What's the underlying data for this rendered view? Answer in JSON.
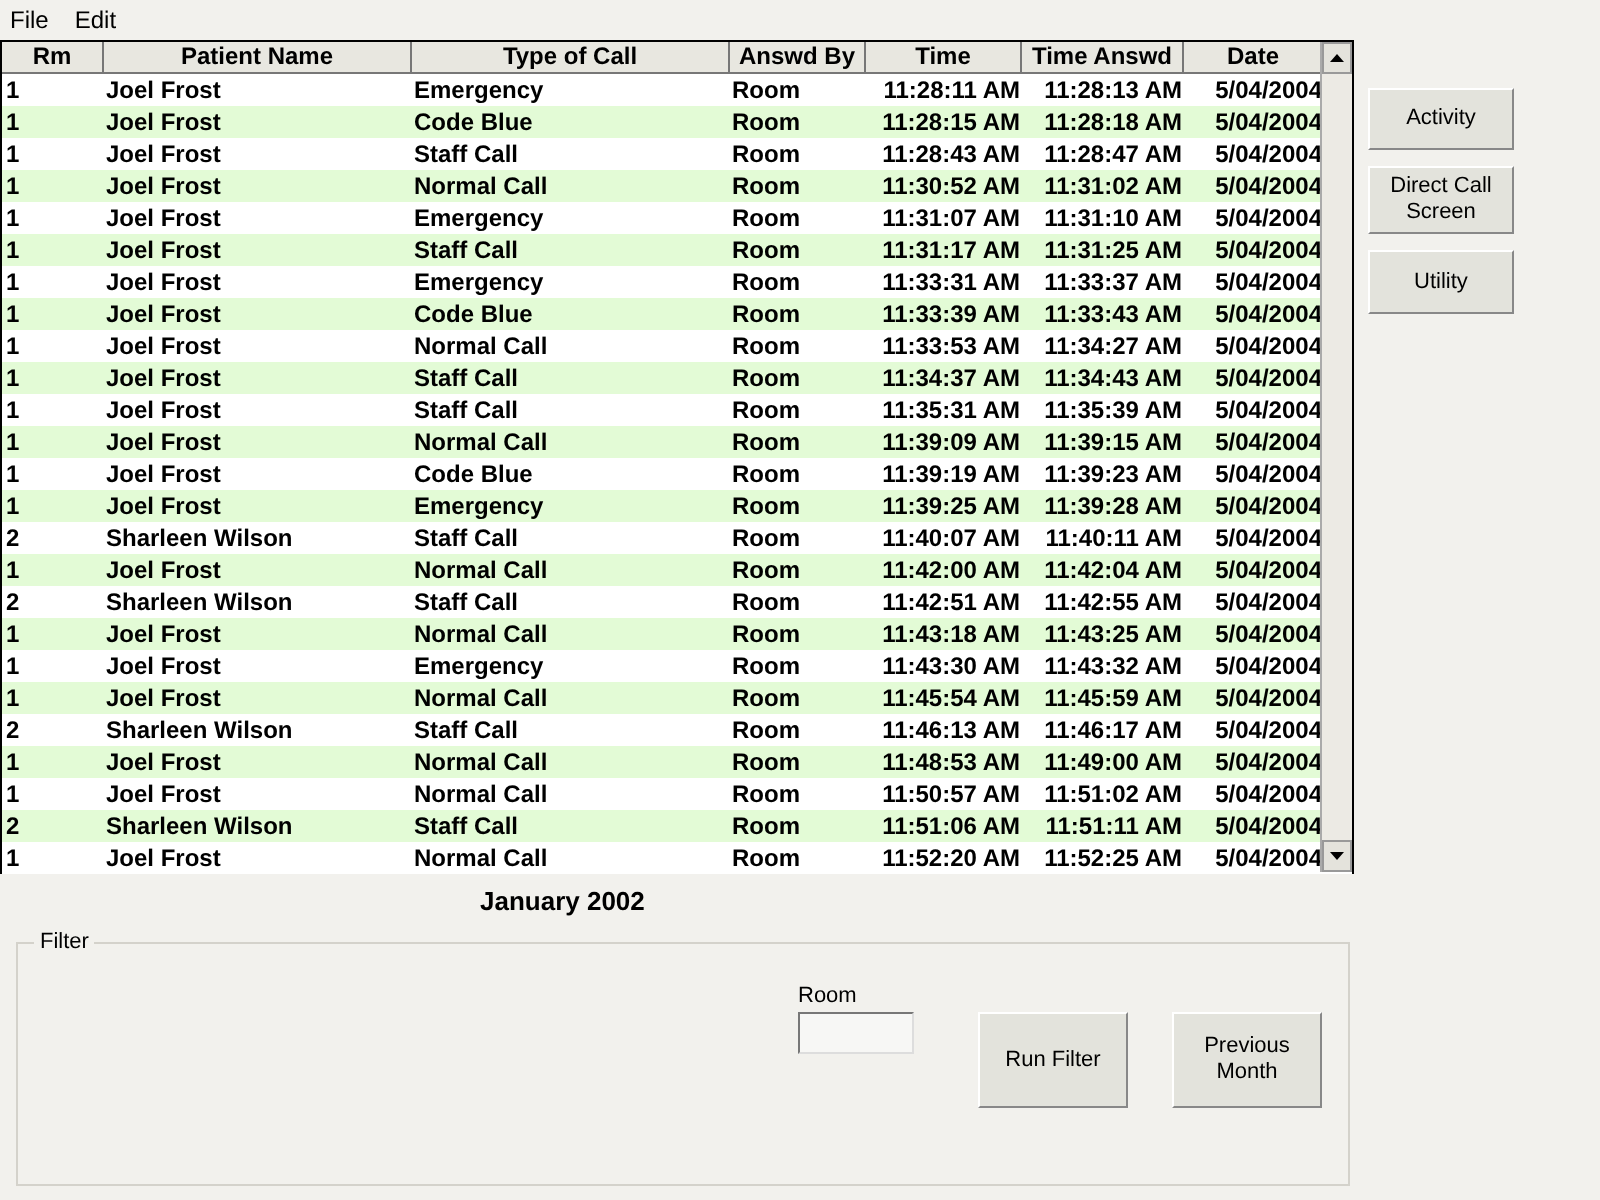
{
  "menu": [
    "File",
    "Edit"
  ],
  "table": {
    "columns": [
      "Rm",
      "Patient Name",
      "Type of Call",
      "Answd By",
      "Time",
      "Time Answd",
      "Date"
    ],
    "rows": [
      [
        "1",
        "Joel Frost",
        "Emergency",
        "Room",
        "11:28:11 AM",
        "11:28:13 AM",
        "5/04/2004"
      ],
      [
        "1",
        "Joel Frost",
        "Code Blue",
        "Room",
        "11:28:15 AM",
        "11:28:18 AM",
        "5/04/2004"
      ],
      [
        "1",
        "Joel Frost",
        "Staff Call",
        "Room",
        "11:28:43 AM",
        "11:28:47 AM",
        "5/04/2004"
      ],
      [
        "1",
        "Joel Frost",
        "Normal Call",
        "Room",
        "11:30:52 AM",
        "11:31:02 AM",
        "5/04/2004"
      ],
      [
        "1",
        "Joel Frost",
        "Emergency",
        "Room",
        "11:31:07 AM",
        "11:31:10 AM",
        "5/04/2004"
      ],
      [
        "1",
        "Joel Frost",
        "Staff Call",
        "Room",
        "11:31:17 AM",
        "11:31:25 AM",
        "5/04/2004"
      ],
      [
        "1",
        "Joel Frost",
        "Emergency",
        "Room",
        "11:33:31 AM",
        "11:33:37 AM",
        "5/04/2004"
      ],
      [
        "1",
        "Joel Frost",
        "Code Blue",
        "Room",
        "11:33:39 AM",
        "11:33:43 AM",
        "5/04/2004"
      ],
      [
        "1",
        "Joel Frost",
        "Normal Call",
        "Room",
        "11:33:53 AM",
        "11:34:27 AM",
        "5/04/2004"
      ],
      [
        "1",
        "Joel Frost",
        "Staff Call",
        "Room",
        "11:34:37 AM",
        "11:34:43 AM",
        "5/04/2004"
      ],
      [
        "1",
        "Joel Frost",
        "Staff Call",
        "Room",
        "11:35:31 AM",
        "11:35:39 AM",
        "5/04/2004"
      ],
      [
        "1",
        "Joel Frost",
        "Normal Call",
        "Room",
        "11:39:09 AM",
        "11:39:15 AM",
        "5/04/2004"
      ],
      [
        "1",
        "Joel Frost",
        "Code Blue",
        "Room",
        "11:39:19 AM",
        "11:39:23 AM",
        "5/04/2004"
      ],
      [
        "1",
        "Joel Frost",
        "Emergency",
        "Room",
        "11:39:25 AM",
        "11:39:28 AM",
        "5/04/2004"
      ],
      [
        "2",
        "Sharleen Wilson",
        "Staff Call",
        "Room",
        "11:40:07 AM",
        "11:40:11 AM",
        "5/04/2004"
      ],
      [
        "1",
        "Joel Frost",
        "Normal Call",
        "Room",
        "11:42:00 AM",
        "11:42:04 AM",
        "5/04/2004"
      ],
      [
        "2",
        "Sharleen Wilson",
        "Staff Call",
        "Room",
        "11:42:51 AM",
        "11:42:55 AM",
        "5/04/2004"
      ],
      [
        "1",
        "Joel Frost",
        "Normal Call",
        "Room",
        "11:43:18 AM",
        "11:43:25 AM",
        "5/04/2004"
      ],
      [
        "1",
        "Joel Frost",
        "Emergency",
        "Room",
        "11:43:30 AM",
        "11:43:32 AM",
        "5/04/2004"
      ],
      [
        "1",
        "Joel Frost",
        "Normal Call",
        "Room",
        "11:45:54 AM",
        "11:45:59 AM",
        "5/04/2004"
      ],
      [
        "2",
        "Sharleen Wilson",
        "Staff Call",
        "Room",
        "11:46:13 AM",
        "11:46:17 AM",
        "5/04/2004"
      ],
      [
        "1",
        "Joel Frost",
        "Normal Call",
        "Room",
        "11:48:53 AM",
        "11:49:00 AM",
        "5/04/2004"
      ],
      [
        "1",
        "Joel Frost",
        "Normal Call",
        "Room",
        "11:50:57 AM",
        "11:51:02 AM",
        "5/04/2004"
      ],
      [
        "2",
        "Sharleen Wilson",
        "Staff Call",
        "Room",
        "11:51:06 AM",
        "11:51:11 AM",
        "5/04/2004"
      ],
      [
        "1",
        "Joel Frost",
        "Normal Call",
        "Room",
        "11:52:20 AM",
        "11:52:25 AM",
        "5/04/2004"
      ]
    ]
  },
  "side_buttons": [
    "Activity",
    "Direct Call Screen",
    "Utility"
  ],
  "month_label": "January 2002",
  "filter": {
    "title": "Filter",
    "room_label": "Room",
    "buttons": [
      "Run Filter",
      "Previous Month"
    ]
  }
}
